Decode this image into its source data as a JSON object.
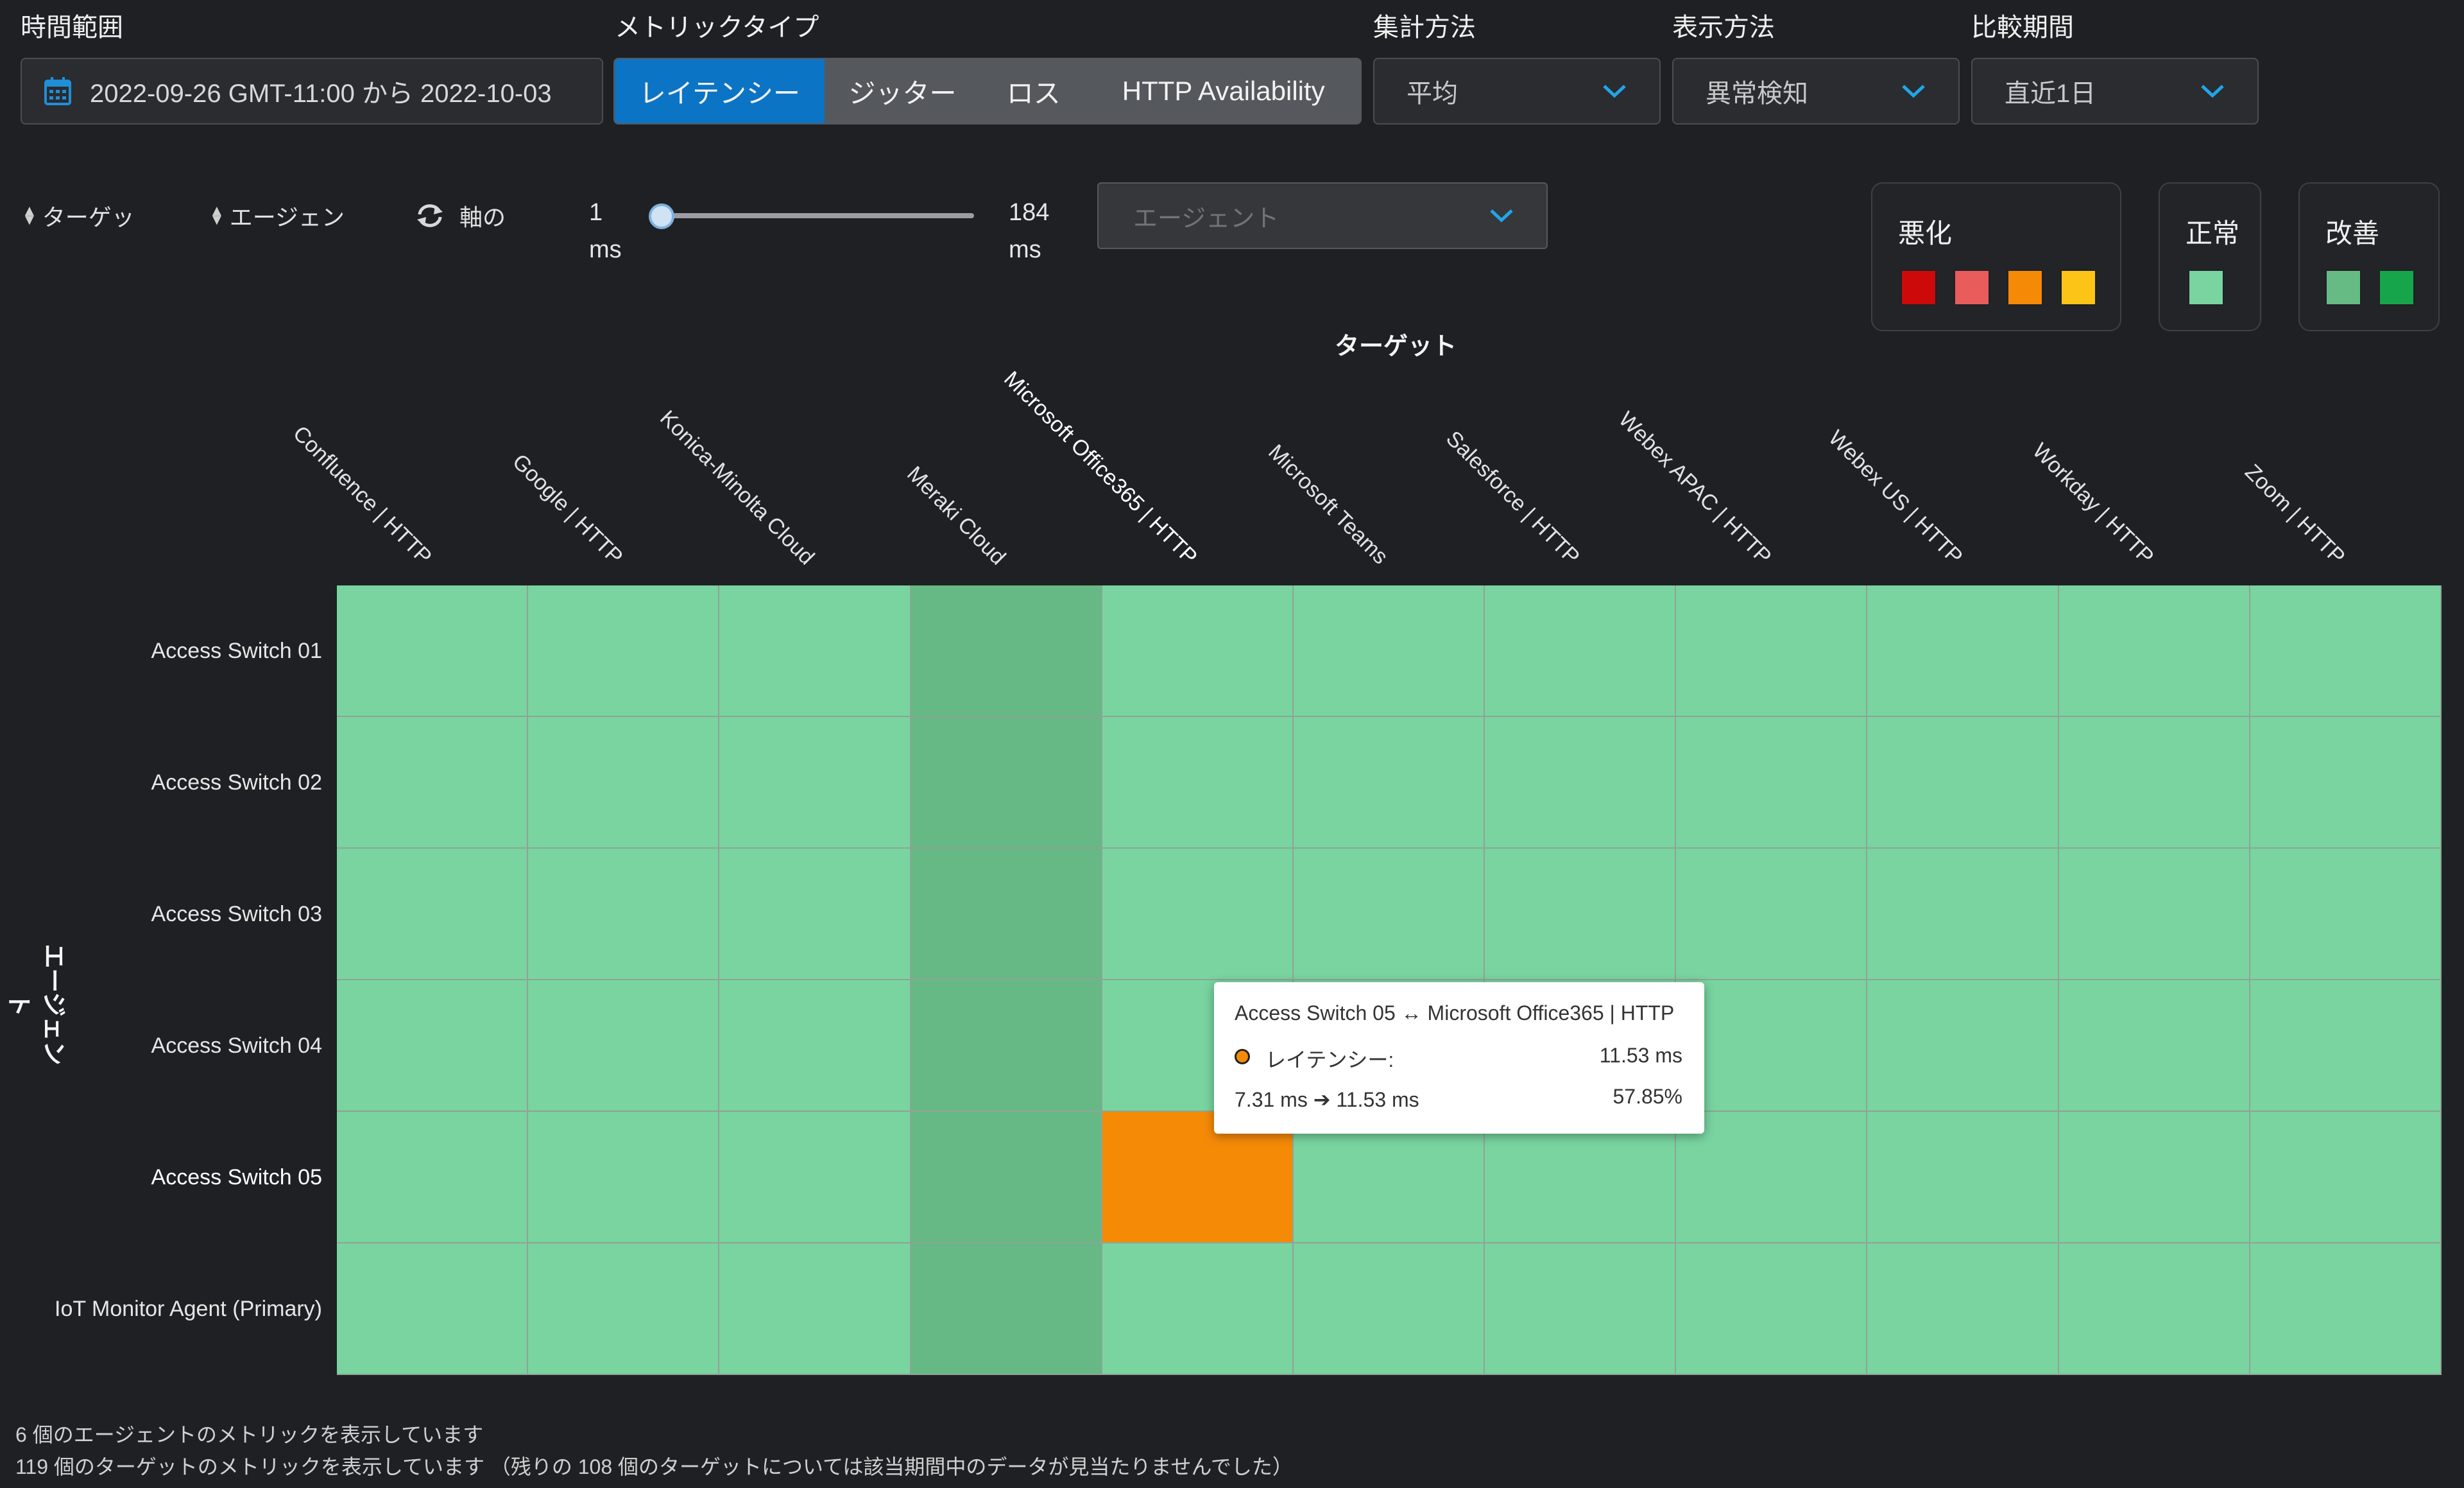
{
  "filters": {
    "time_range_label": "時間範囲",
    "time_range_value": "2022-09-26 GMT-11:00 から 2022-10-03",
    "metric_type_label": "メトリックタイプ",
    "metric_types": [
      "レイテンシー",
      "ジッター",
      "ロス",
      "HTTP Availability"
    ],
    "metric_type_selected": "レイテンシー",
    "aggregation_label": "集計方法",
    "aggregation_value": "平均",
    "display_label": "表示方法",
    "display_value": "異常検知",
    "compare_label": "比較期間",
    "compare_value": "直近1日"
  },
  "controls": {
    "sort_target": "ターゲッ",
    "sort_agent": "エージェン",
    "swap_axes": "軸の",
    "range_min": "1",
    "range_max": "184",
    "range_unit": "ms",
    "slider_position": 0,
    "agent_placeholder": "エージェント"
  },
  "legend": {
    "worse_label": "悪化",
    "worse_colors": [
      "#cc0a0a",
      "#e85c5c",
      "#f58a07",
      "#fcc417"
    ],
    "normal_label": "正常",
    "normal_colors": [
      "#79d4a0"
    ],
    "better_label": "改善",
    "better_colors": [
      "#66bb84",
      "#16a54a"
    ]
  },
  "heatmap": {
    "x_title": "ターゲット",
    "y_title": "エージェント",
    "targets": [
      "Confluence | HTTP",
      "Google | HTTP",
      "Konica-Minolta Cloud",
      "Meraki Cloud",
      "Microsoft Office365 | HTTP",
      "Microsoft Teams",
      "Salesforce | HTTP",
      "Webex APAC | HTTP",
      "Webex US | HTTP",
      "Workday | HTTP",
      "Zoom | HTTP"
    ],
    "agents": [
      "Access Switch 01",
      "Access Switch 02",
      "Access Switch 03",
      "Access Switch 04",
      "Access Switch 05",
      "IoT Monitor Agent (Primary)"
    ],
    "highlighted_column": 3,
    "highlighted_row": 4,
    "normal_color": "#79d4a0",
    "hover_column_color": "#66b884",
    "anomaly_cells": [
      {
        "agent": "Access Switch 05",
        "target": "Microsoft Office365 | HTTP",
        "color": "#f58a07"
      }
    ]
  },
  "tooltip": {
    "title": "Access Switch 05 ↔ Microsoft Office365 | HTTP",
    "metric": "レイテンシー:",
    "value": "11.53 ms",
    "change": "7.31 ms ➔ 11.53 ms",
    "percent": "57.85%",
    "dot_color": "#f58a07"
  },
  "footer": {
    "line1": "6 個のエージェントのメトリックを表示しています",
    "line2": "119 個のターゲットのメトリックを表示しています （残りの 108 個のターゲットについては該当期間中のデータが見当たりませんでした）"
  }
}
